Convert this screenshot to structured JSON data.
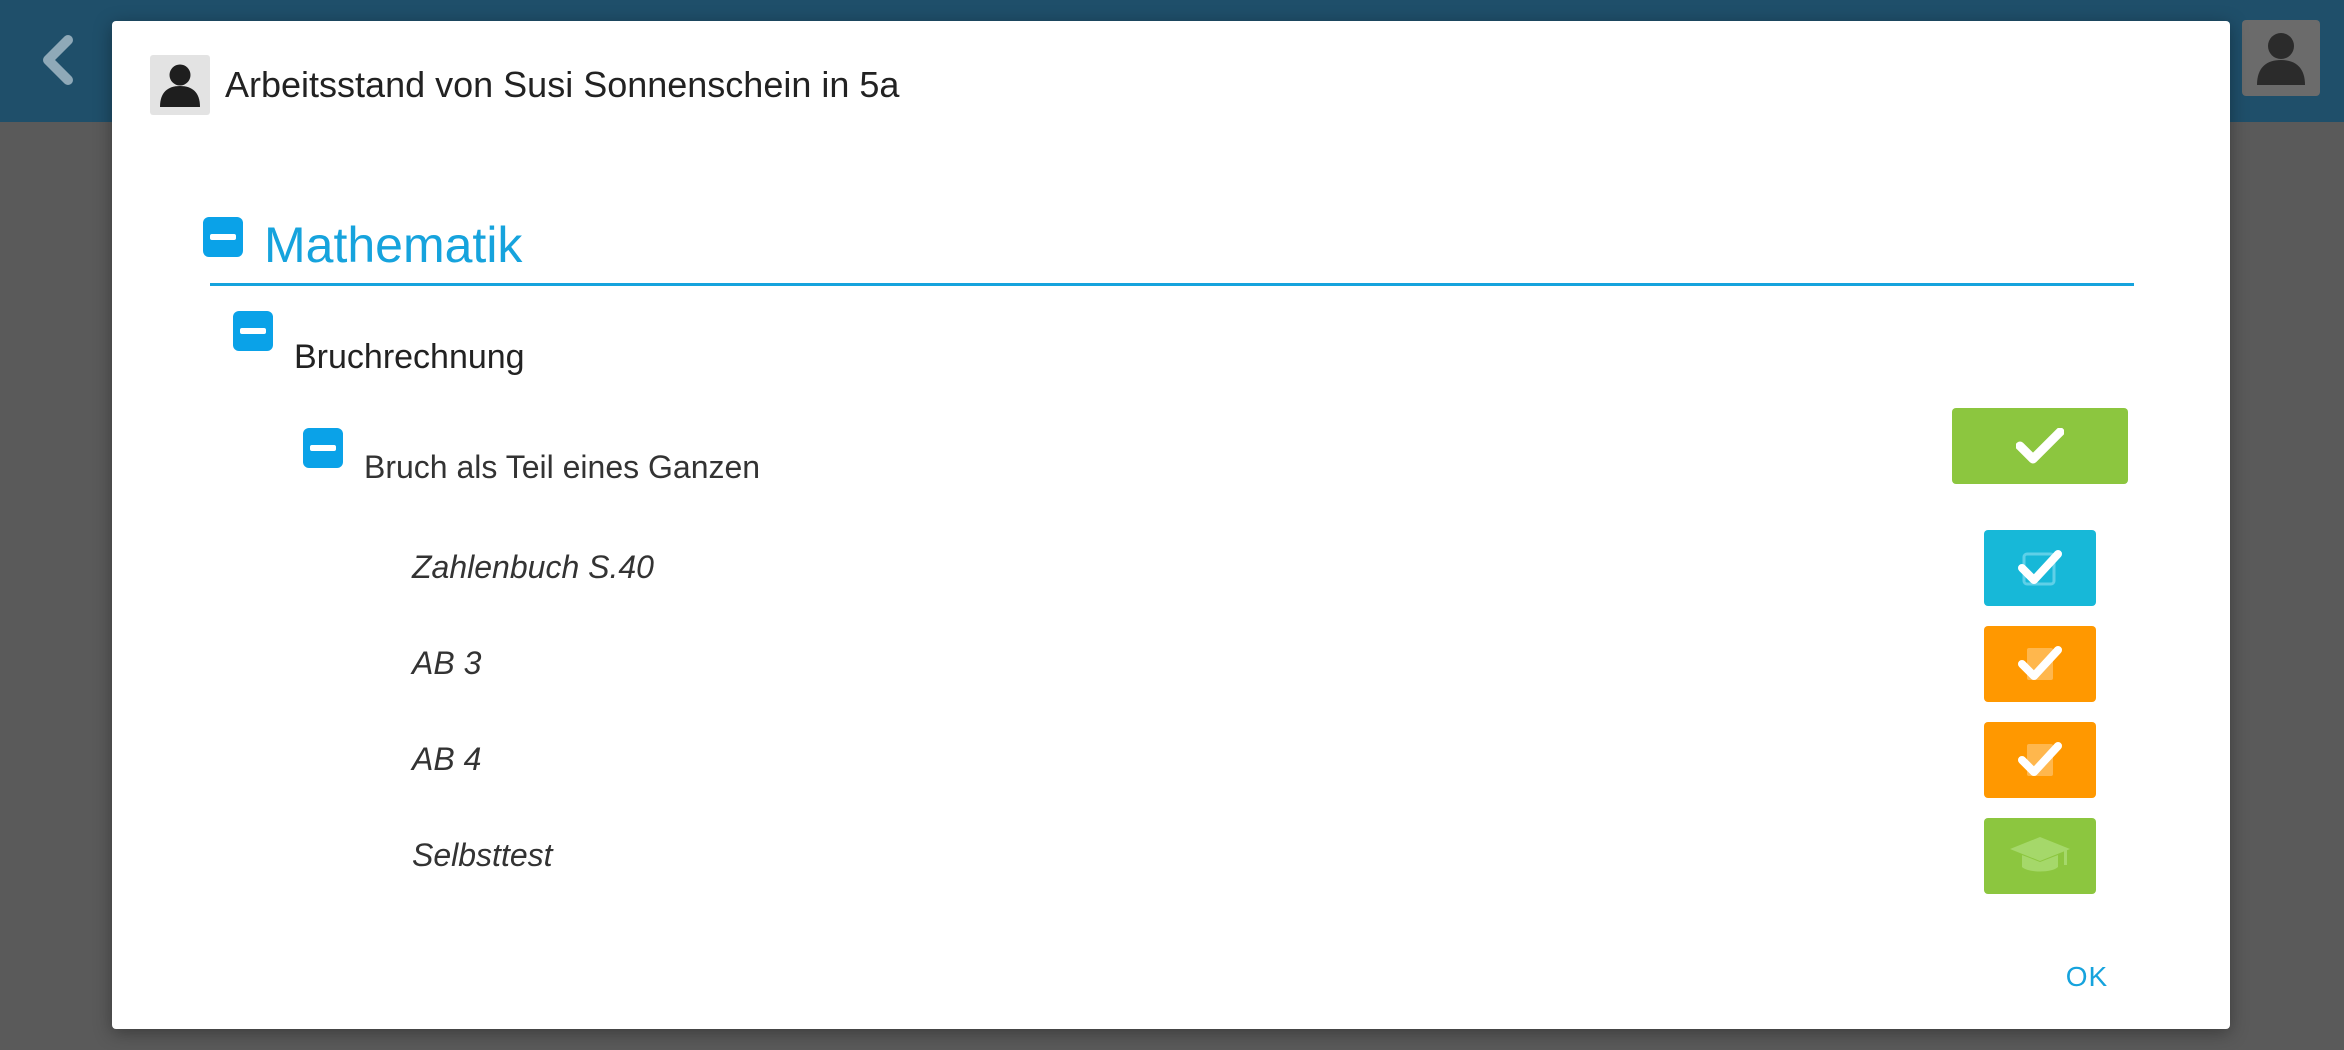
{
  "colors": {
    "accent_blue": "#16a3dd",
    "toggle_blue": "#0aa2e8",
    "done_green": "#8cc63f",
    "cyan": "#17b8d8",
    "orange": "#ff9800",
    "light_green": "#8cc63f"
  },
  "icons": {
    "back": "chevron-left-icon",
    "user": "user-icon",
    "check": "check-icon",
    "graduation": "graduation-cap-icon",
    "collapse": "minus-icon"
  },
  "dialog": {
    "title": "Arbeitsstand von Susi Sonnenschein in 5a",
    "subject": "Mathematik",
    "topic": "Bruchrechnung",
    "unit": "Bruch als Teil eines Ganzen",
    "unit_status": "done",
    "tasks": [
      {
        "label": "Zahlenbuch S.40",
        "status": "checked",
        "color": "cyan"
      },
      {
        "label": "AB 3",
        "status": "checked",
        "color": "orange"
      },
      {
        "label": "AB 4",
        "status": "checked",
        "color": "orange"
      },
      {
        "label": "Selbsttest",
        "status": "test",
        "color": "light-green"
      }
    ],
    "ok_label": "OK"
  }
}
